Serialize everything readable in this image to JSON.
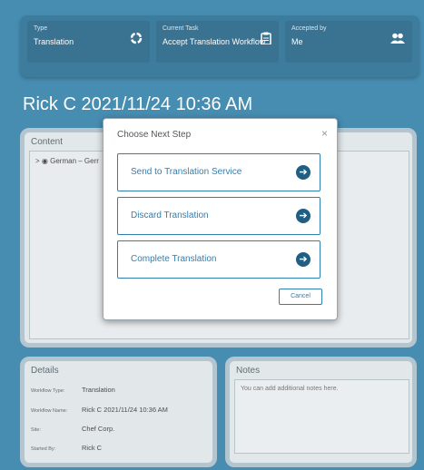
{
  "header": {
    "type": {
      "label": "Type",
      "value": "Translation",
      "icon": "refresh-icon"
    },
    "task": {
      "label": "Current Task",
      "value": "Accept Translation Workflow",
      "icon": "clipboard-icon"
    },
    "accepted": {
      "label": "Accepted by",
      "value": "Me",
      "icon": "users-icon"
    }
  },
  "page_title": "Rick C 2021/11/24 10:36 AM",
  "content": {
    "heading": "Content",
    "tree_item": "German – Gerr"
  },
  "details": {
    "heading": "Details",
    "rows": [
      {
        "key": "Workflow Type:",
        "value": "Translation"
      },
      {
        "key": "Workflow Name:",
        "value": "Rick C 2021/11/24 10:36 AM"
      },
      {
        "key": "Site:",
        "value": "Chef Corp."
      },
      {
        "key": "Started By:",
        "value": "Rick C"
      }
    ]
  },
  "notes": {
    "heading": "Notes",
    "placeholder": "You can add additional notes here."
  },
  "modal": {
    "title": "Choose Next Step",
    "close": "×",
    "options": [
      {
        "label": "Send to Translation Service",
        "icon": "arrow-right-circle-icon"
      },
      {
        "label": "Discard Translation",
        "icon": "arrow-right-circle-icon"
      },
      {
        "label": "Complete Translation",
        "icon": "arrow-right-circle-icon"
      }
    ],
    "cancel": "Cancel"
  },
  "colors": {
    "background": "#2e7ea8",
    "accent": "#2f7fb0",
    "card": "#1f5f83"
  }
}
